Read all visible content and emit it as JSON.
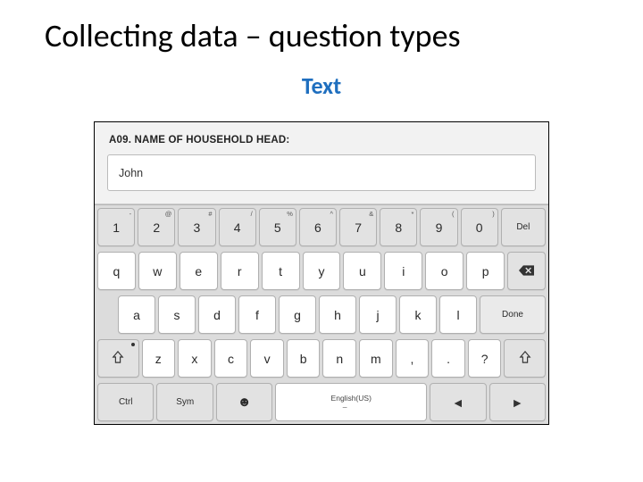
{
  "slide": {
    "title": "Collecting data – question types",
    "subtitle": "Text"
  },
  "form": {
    "question_label": "A09. NAME OF HOUSEHOLD HEAD:",
    "input_value": "John"
  },
  "keyboard": {
    "num_row": [
      {
        "main": "1",
        "sup": "-"
      },
      {
        "main": "2",
        "sup": "@"
      },
      {
        "main": "3",
        "sup": "#"
      },
      {
        "main": "4",
        "sup": "/"
      },
      {
        "main": "5",
        "sup": "%"
      },
      {
        "main": "6",
        "sup": "^"
      },
      {
        "main": "7",
        "sup": "&"
      },
      {
        "main": "8",
        "sup": "*"
      },
      {
        "main": "9",
        "sup": "("
      },
      {
        "main": "0",
        "sup": ")"
      }
    ],
    "del_label": "Del",
    "row_q": [
      "q",
      "w",
      "e",
      "r",
      "t",
      "y",
      "u",
      "i",
      "o",
      "p"
    ],
    "row_a": [
      "a",
      "s",
      "d",
      "f",
      "g",
      "h",
      "j",
      "k",
      "l"
    ],
    "done_label": "Done",
    "row_z": [
      "z",
      "x",
      "c",
      "v",
      "b",
      "n",
      "m",
      ",",
      ".",
      "?"
    ],
    "bottom": {
      "ctrl": "Ctrl",
      "sym": "Sym",
      "space_lang": "English(US)",
      "left": "◄",
      "right": "►"
    }
  }
}
